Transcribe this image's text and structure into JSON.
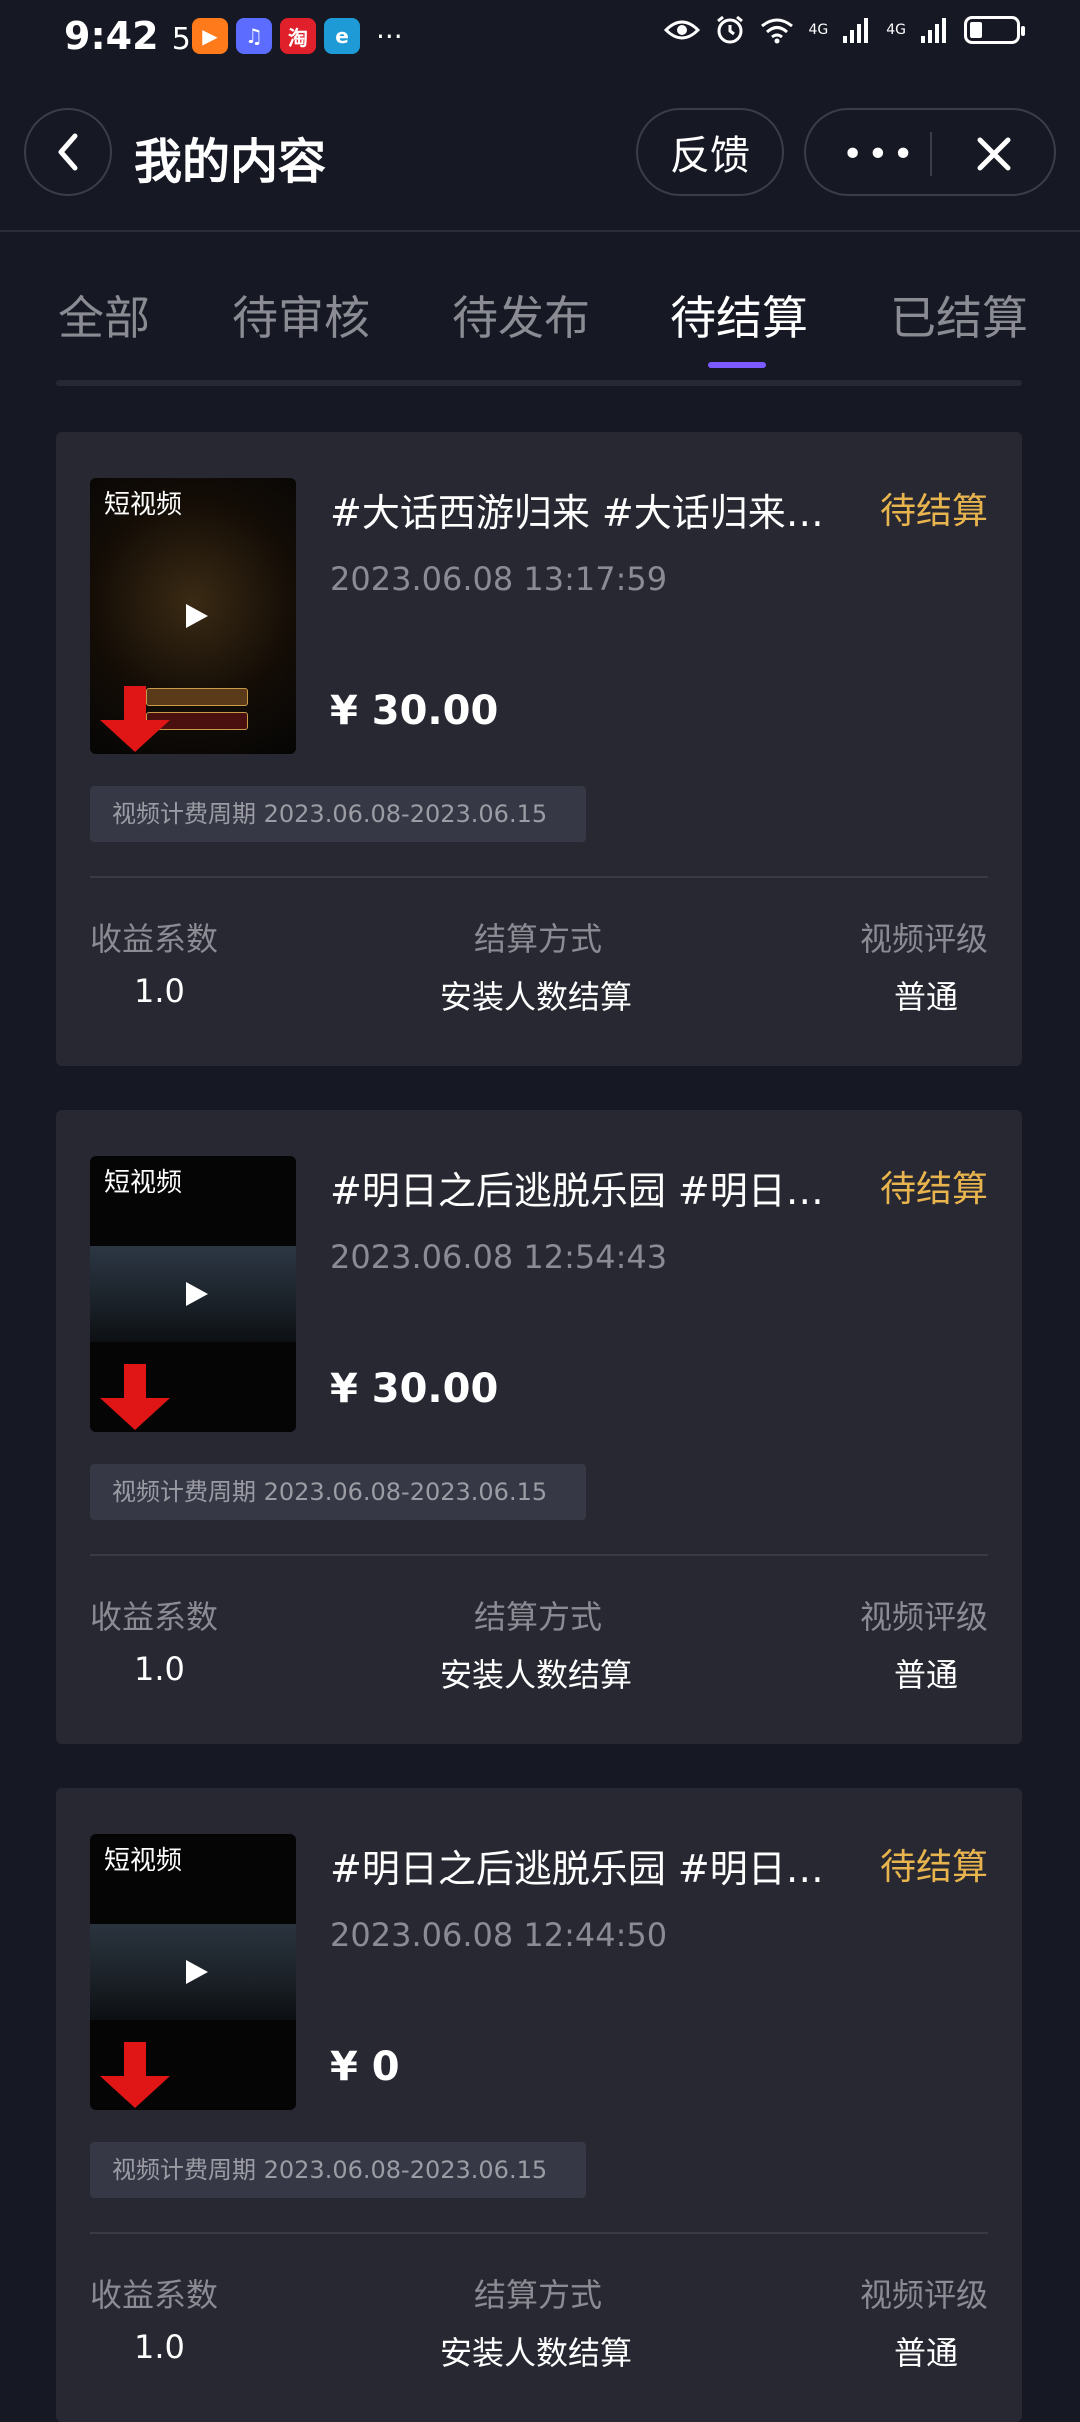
{
  "status_bar": {
    "time": "9:42",
    "seconds": "58",
    "apps": [
      {
        "name": "video-app-icon",
        "glyph": "▶",
        "color": "#ff7a1a"
      },
      {
        "name": "music-app-icon",
        "glyph": "♫",
        "color": "#5b6cff"
      },
      {
        "name": "taobao-app-icon",
        "glyph": "淘",
        "color": "#e0202a"
      },
      {
        "name": "browser-app-icon",
        "glyph": "e",
        "color": "#1e9bd7"
      }
    ],
    "more": "···",
    "network_1": "4G",
    "network_2": "4G"
  },
  "nav": {
    "title": "我的内容",
    "feedback_label": "反馈",
    "more_label": "•••"
  },
  "tabs": [
    {
      "label": "全部"
    },
    {
      "label": "待审核"
    },
    {
      "label": "待发布"
    },
    {
      "label": "待结算",
      "active": true
    },
    {
      "label": "已结算"
    }
  ],
  "cards": [
    {
      "thumb_label": "短视频",
      "title": "#大话西游归来 #大话归来合集 #游戏",
      "status": "待结算",
      "date": "2023.06.08 13:17:59",
      "price": "¥ 30.00",
      "period": "视频计费周期 2023.06.08-2023.06.15",
      "metric_labels": [
        "收益系数",
        "结算方式",
        "视频评级"
      ],
      "metric_values": [
        "1.0",
        "安装人数结算",
        "普通"
      ]
    },
    {
      "thumb_label": "短视频",
      "title": "#明日之后逃脱乐园 #明日之后 #游戏",
      "status": "待结算",
      "date": "2023.06.08 12:54:43",
      "price": "¥ 30.00",
      "period": "视频计费周期 2023.06.08-2023.06.15",
      "metric_labels": [
        "收益系数",
        "结算方式",
        "视频评级"
      ],
      "metric_values": [
        "1.0",
        "安装人数结算",
        "普通"
      ]
    },
    {
      "thumb_label": "短视频",
      "title": "#明日之后逃脱乐园 #明日之后 #游戏",
      "status": "待结算",
      "date": "2023.06.08 12:44:50",
      "price": "¥ 0",
      "period": "视频计费周期 2023.06.08-2023.06.15",
      "metric_labels": [
        "收益系数",
        "结算方式",
        "视频评级"
      ],
      "metric_values": [
        "1.0",
        "安装人数结算",
        "普通"
      ]
    }
  ],
  "colors": {
    "background": "#161823",
    "card": "#272832",
    "status_accent": "#e8b44d",
    "tab_indicator": "#7b5bff"
  }
}
